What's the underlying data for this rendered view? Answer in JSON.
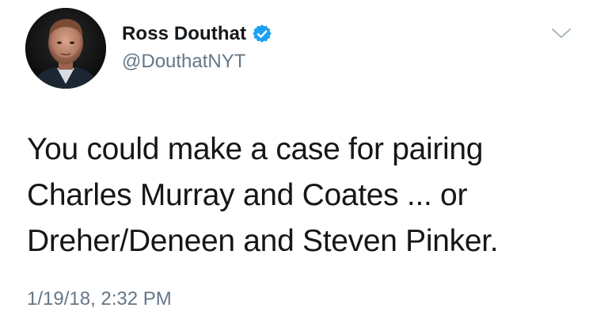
{
  "author": {
    "display_name": "Ross Douthat",
    "handle": "@DouthatNYT",
    "verified_icon": "verified-badge-icon",
    "avatar_icon": "profile-photo"
  },
  "tweet": {
    "lines": [
      "You could make a case for pairing",
      "Charles Murray and Coates ... or",
      "Dreher/Deneen and Steven Pinker."
    ],
    "timestamp": "1/19/18, 2:32 PM"
  },
  "menu": {
    "icon": "chevron-down-icon"
  },
  "colors": {
    "text": "#14171a",
    "secondary": "#657786",
    "verified": "#1da1f2",
    "chevron": "#aab8c2"
  }
}
